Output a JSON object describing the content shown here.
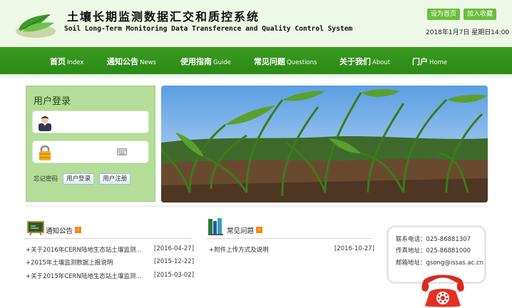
{
  "header": {
    "title_cn": "土壤长期监测数据汇交和质控系统",
    "title_en": "Soil Long-Term Monitoring Data Transference and Quality Control System",
    "set_home_label": "设为首页",
    "add_favorite_label": "加入收藏",
    "datetime": "2018年1月7日  星期日14:00"
  },
  "nav": {
    "items": [
      {
        "cn": "首页",
        "en": "Index"
      },
      {
        "cn": "通知公告",
        "en": "News"
      },
      {
        "cn": "使用指南",
        "en": "Guide"
      },
      {
        "cn": "常见问题",
        "en": "Questions"
      },
      {
        "cn": "关于我们",
        "en": "About"
      },
      {
        "cn": "门户",
        "en": "Home"
      }
    ]
  },
  "login": {
    "title": "用户登录",
    "username_placeholder": "",
    "password_placeholder": "",
    "forgot_label": "忘记密码",
    "login_label": "用户登录",
    "register_label": "用户注册"
  },
  "notices": {
    "title": "通知公告",
    "items": [
      {
        "text": "+关于2016年CERN陆地生态站土壤监测...",
        "date": "[2016-04-27]"
      },
      {
        "text": "+2015年土壤监测数据上报说明",
        "date": "[2015-12-22]"
      },
      {
        "text": "+关于2015年CERN陆地生态站土壤监测...",
        "date": "[2015-03-02]"
      }
    ]
  },
  "faq": {
    "title": "常见问题",
    "items": [
      {
        "text": "+附件上传方式及说明",
        "date": "[2016-10-27]"
      }
    ]
  },
  "contact": {
    "phone": "联系电话：025-86881307",
    "fax": "传真地址：025-86881000",
    "email": "邮箱地址：gsong@issas.ac.cn"
  },
  "colors": {
    "nav_green": "#2b8a16",
    "header_bg": "#eef8e6",
    "login_bg": "#b3dd98",
    "accent_orange": "#f08a1c"
  },
  "icons": {
    "logo": "leaf-logo",
    "user": "user-avatar-icon",
    "lock": "lock-icon",
    "keyboard": "keyboard-icon",
    "notice": "blackboard-icon",
    "faq": "books-icon",
    "phone": "telephone-icon"
  }
}
